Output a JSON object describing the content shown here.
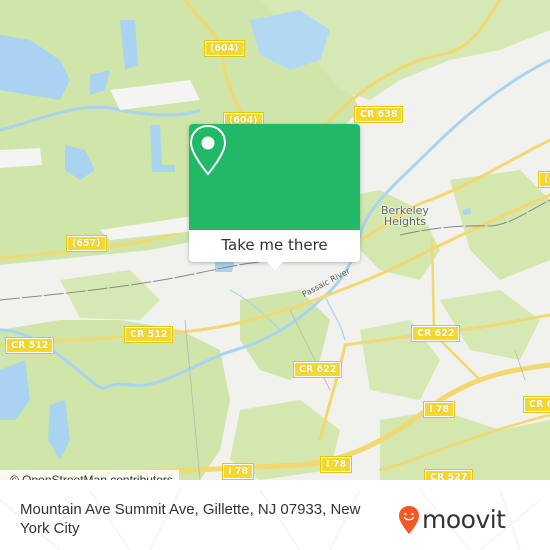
{
  "map": {
    "road_labels": [
      {
        "id": "604-top",
        "text": "(604)"
      },
      {
        "id": "604-mid",
        "text": "(604)"
      },
      {
        "id": "cr638",
        "text": "CR 638"
      },
      {
        "id": "657",
        "text": "(657)"
      },
      {
        "id": "cr512-left",
        "text": "CR 512"
      },
      {
        "id": "cr512-mid",
        "text": "CR 512"
      },
      {
        "id": "cr622-right",
        "text": "CR 622"
      },
      {
        "id": "cr622-mid",
        "text": "CR 622"
      },
      {
        "id": "i78-right",
        "text": "I 78"
      },
      {
        "id": "i78-mid",
        "text": "I 78"
      },
      {
        "id": "i78-left",
        "text": "I 78"
      },
      {
        "id": "cr527",
        "text": "CR 527"
      },
      {
        "id": "cr-edge-right",
        "text": "CR 6"
      },
      {
        "id": "edge-right-top",
        "text": "("
      }
    ],
    "place_label": "Berkeley\nHeights",
    "place_line1": "Berkeley",
    "place_line2": "Heights",
    "river_label": "Passaic River",
    "attribution": "© OpenStreetMap contributors",
    "colors": {
      "land": "#f1f1ee",
      "forest": "#cfe5aa",
      "water": "#a9d3f0",
      "road": "#f2d870",
      "shield": "#f5d829"
    }
  },
  "popup": {
    "icon": "map-pin-icon",
    "button_label": "Take me there",
    "accent_color": "#21b868"
  },
  "footer": {
    "address": "Mountain Ave Summit Ave, Gillette, NJ 07933, New York City",
    "logo_text": "moovit",
    "logo_icon": "moovit-smile-pin-icon",
    "logo_color": "#f05a28"
  }
}
